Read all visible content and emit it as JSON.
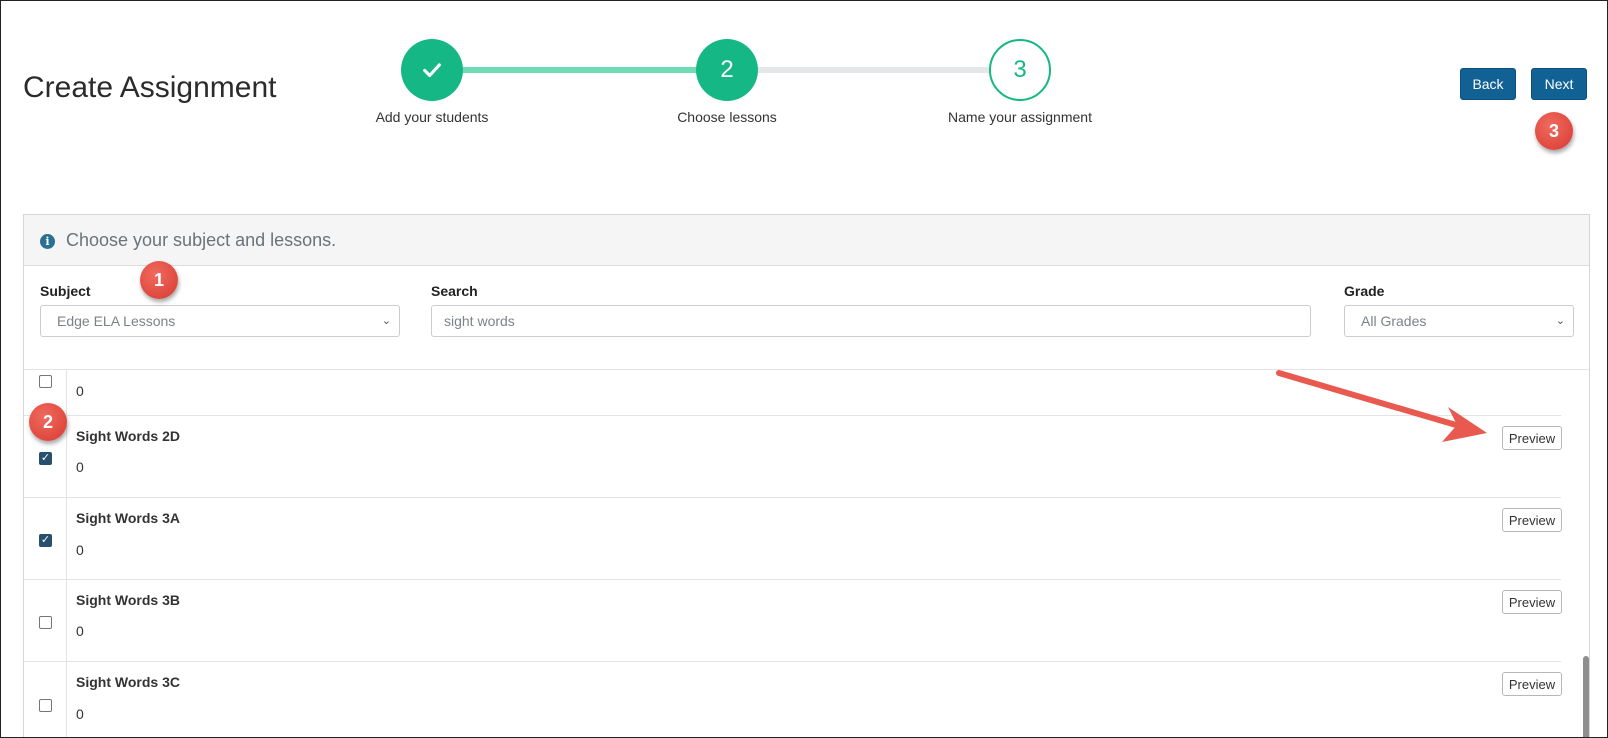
{
  "page": {
    "title": "Create Assignment"
  },
  "stepper": {
    "steps": [
      {
        "label": "Add your students",
        "state": "complete",
        "icon": "check-icon"
      },
      {
        "label": "Choose lessons",
        "number": "2",
        "state": "active"
      },
      {
        "label": "Name your assignment",
        "number": "3",
        "state": "upcoming"
      }
    ]
  },
  "toolbar": {
    "back_label": "Back",
    "next_label": "Next"
  },
  "panel": {
    "title": "Choose your subject and lessons.",
    "subject": {
      "label": "Subject",
      "value": "Edge ELA Lessons"
    },
    "search": {
      "label": "Search",
      "value": "sight words"
    },
    "grade": {
      "label": "Grade",
      "value": "All Grades"
    }
  },
  "lessons": [
    {
      "name": "",
      "count": "0",
      "checked": false
    },
    {
      "name": "Sight Words 2D",
      "count": "0",
      "checked": true,
      "preview_label": "Preview"
    },
    {
      "name": "Sight Words 3A",
      "count": "0",
      "checked": true,
      "preview_label": "Preview"
    },
    {
      "name": "Sight Words 3B",
      "count": "0",
      "checked": false,
      "preview_label": "Preview"
    },
    {
      "name": "Sight Words 3C",
      "count": "0",
      "checked": false,
      "preview_label": "Preview"
    }
  ],
  "annotations": {
    "badge_1": "1",
    "badge_2": "2",
    "badge_3": "3"
  },
  "colors": {
    "primary": "#126195",
    "step_green": "#15b884",
    "annotation_red": "#e04a3f"
  }
}
